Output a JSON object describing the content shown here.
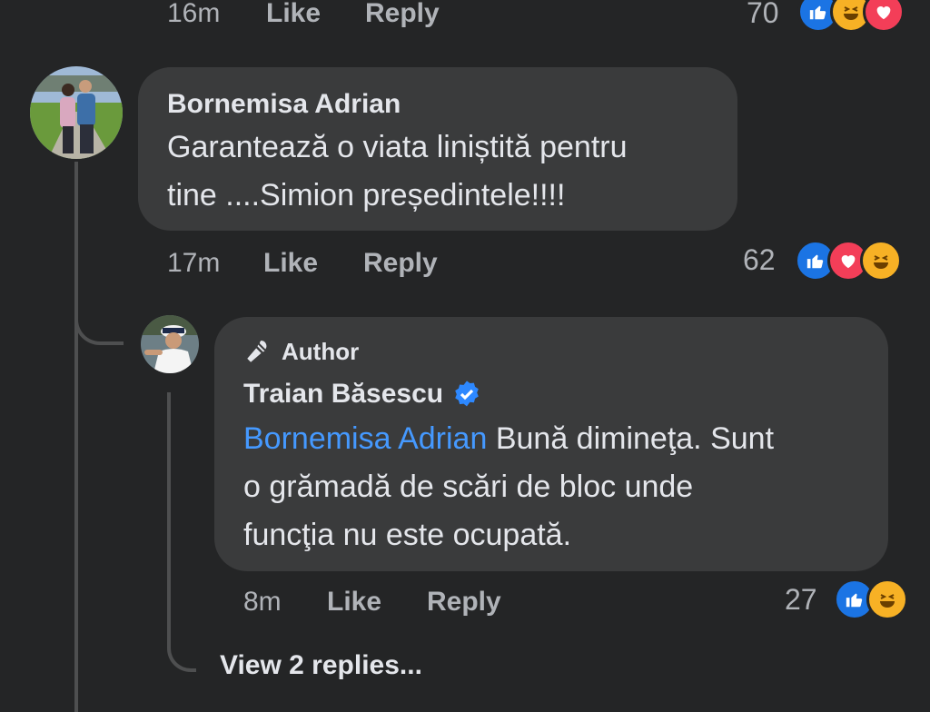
{
  "top_comment": {
    "time": "16m",
    "like": "Like",
    "reply": "Reply",
    "reaction_count": "70",
    "reactions": [
      "like-icon",
      "haha-icon",
      "heart-icon"
    ]
  },
  "comment1": {
    "author": "Bornemisa Adrian",
    "text_line1": "Garantează o viata liniștită pentru",
    "text_line2": "tine ....Simion președintele!!!!",
    "time": "17m",
    "like": "Like",
    "reply": "Reply",
    "reaction_count": "62",
    "reactions": [
      "like-icon",
      "heart-icon",
      "haha-icon"
    ]
  },
  "comment2": {
    "badge": "Author",
    "author": "Traian Băsescu",
    "verified": true,
    "mention": "Bornemisa Adrian",
    "text_line1_rest": " Bună dimineţa. Sunt",
    "text_line2": "o grămadă de scări de bloc unde",
    "text_line3": "funcţia nu este ocupată.",
    "time": "8m",
    "like": "Like",
    "reply": "Reply",
    "reaction_count": "27",
    "reactions": [
      "like-icon",
      "haha-icon"
    ]
  },
  "view_replies": "View 2 replies...",
  "colors": {
    "background": "#242526",
    "bubble": "#3a3b3c",
    "mention": "#4599ff",
    "like": "#1b74e4",
    "heart": "#f33e58",
    "haha": "#f7b125"
  }
}
